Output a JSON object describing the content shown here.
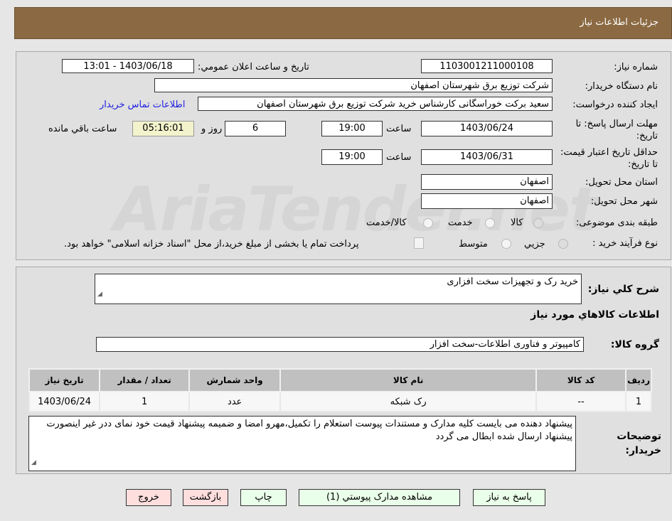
{
  "header": {
    "title": "جزئیات اطلاعات نیاز"
  },
  "watermark": "AriaTender.net",
  "fields": {
    "need_number_label": "شماره نیاز:",
    "need_number": "1103001211000108",
    "announce_label": "تاریخ و ساعت اعلان عمومي:",
    "announce_value": "1403/06/18 - 13:01",
    "buyer_org_label": "نام دستگاه خریدار:",
    "buyer_org": "شرکت توزیع برق شهرستان اصفهان",
    "creator_label": "ایجاد کننده درخواست:",
    "creator": "سعید برکت خوراسگانی کارشناس خرید شرکت توزیع برق شهرستان اصفهان",
    "contact_link": "اطلاعات تماس خریدار",
    "deadline_label": "مهلت ارسال پاسخ: تا تاریخ:",
    "deadline_date": "1403/06/24",
    "time_label": "ساعت",
    "deadline_time": "19:00",
    "days": "6",
    "days_label": "روز و",
    "remaining": "05:16:01",
    "remaining_label": "ساعت باقي مانده",
    "validity_label": "حداقل تاریخ اعتبار قیمت: تا تاریخ:",
    "validity_date": "1403/06/31",
    "validity_time": "19:00",
    "province_label": "استان محل تحویل:",
    "province": "اصفهان",
    "city_label": "شهر محل تحویل:",
    "city": "اصفهان",
    "category_label": "طبقه بندی موضوعی:",
    "category_options": [
      "کالا",
      "خدمت",
      "کالا/خدمت"
    ],
    "category_selected": "کالا",
    "process_label": "نوع فرآیند خرید :",
    "process_options": [
      "جزیي",
      "متوسط"
    ],
    "process_selected": "جزیي",
    "payment_note": "پرداخت تمام یا بخشی از مبلغ خرید،از محل \"اسناد خزانه اسلامی\" خواهد بود."
  },
  "details": {
    "summary_label": "شرح کلي نیاز:",
    "summary": "خرید رک و تجهیزات سخت افزاری",
    "goods_heading": "اطلاعات کالاهاي مورد نیاز",
    "group_label": "گروه کالا:",
    "group": "کامپیوتر و فناوری اطلاعات-سخت افزار",
    "table": {
      "headers": [
        "ردیف",
        "کد کالا",
        "نام کالا",
        "واحد شمارش",
        "تعداد / مقدار",
        "تاریخ نیاز"
      ],
      "rows": [
        [
          "1",
          "--",
          "رک شبکه",
          "عدد",
          "1",
          "1403/06/24"
        ]
      ]
    },
    "notes_label": "توضیحات خریدار:",
    "notes": "پیشنهاد دهنده می بایست کلیه مدارک و مستندات پیوست استعلام را تکمیل،مهرو امضا و ضمیمه پیشنهاد قیمت خود نمای ددر غیر اینصورت پیشنهاد ارسال شده ابطال می گردد"
  },
  "buttons": {
    "reply": "پاسخ به نیاز",
    "attachments": "مشاهده مدارک پیوستي (1)",
    "print": "چاپ",
    "back": "بازگشت",
    "exit": "خروج"
  }
}
